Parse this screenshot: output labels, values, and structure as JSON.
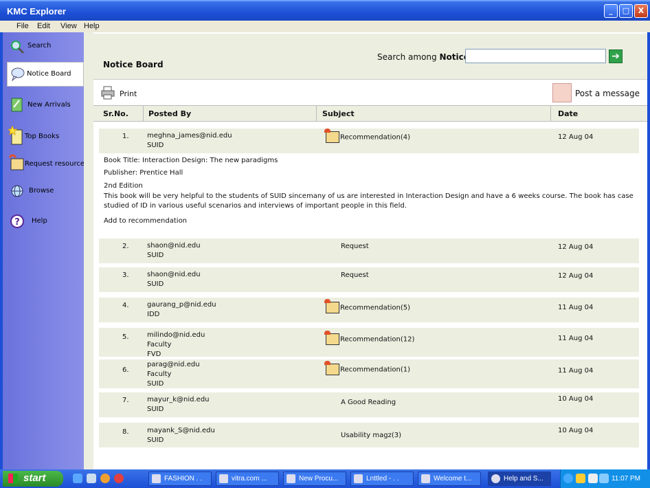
{
  "window": {
    "title": "KMC Explorer",
    "min": "_",
    "max": "□",
    "close": "X"
  },
  "menu": [
    "File",
    "Edit",
    "View",
    "Help"
  ],
  "sidebar": {
    "items": [
      {
        "label": "Search",
        "icon": "magnifier-icon"
      },
      {
        "label": "Notice Board",
        "icon": "speech-bubble-icon"
      },
      {
        "label": "New Arrivals",
        "icon": "book-icon"
      },
      {
        "label": "Top Books",
        "icon": "star-book-icon"
      },
      {
        "label": "Request resource",
        "icon": "folder-arrow-icon"
      },
      {
        "label": "Browse",
        "icon": "globe-icon"
      },
      {
        "label": "Help",
        "icon": "question-icon"
      }
    ]
  },
  "header": {
    "title": "Notice Board",
    "search_label": "Search among ",
    "search_label_bold": "Notices",
    "search_value": "",
    "go": "➔"
  },
  "toolbar": {
    "print": "Print",
    "post": "Post a message"
  },
  "table": {
    "columns": [
      "Sr.No.",
      "Posted By",
      "Subject",
      "Date"
    ],
    "rows": [
      {
        "num": "1.",
        "by": [
          "meghna_james@nid.edu",
          "SUID"
        ],
        "subject": "Recommendation(4)",
        "folder": true,
        "date": "12 Aug 04"
      },
      {
        "num": "2.",
        "by": [
          "shaon@nid.edu",
          "SUID"
        ],
        "subject": "Request",
        "folder": false,
        "date": "12 Aug 04"
      },
      {
        "num": "3.",
        "by": [
          "shaon@nid.edu",
          "SUID"
        ],
        "subject": "Request",
        "folder": false,
        "date": "12 Aug 04"
      },
      {
        "num": "4.",
        "by": [
          "gaurang_p@nid.edu",
          "IDD"
        ],
        "subject": "Recommendation(5)",
        "folder": true,
        "date": "11 Aug 04"
      },
      {
        "num": "5.",
        "by": [
          "milindo@nid.edu",
          "Faculty",
          "FVD"
        ],
        "subject": "Recommendation(12)",
        "folder": true,
        "date": "11 Aug 04"
      },
      {
        "num": "6.",
        "by": [
          "parag@nid.edu",
          "Faculty",
          "SUID"
        ],
        "subject": "Recommendation(1)",
        "folder": true,
        "date": "11 Aug 04"
      },
      {
        "num": "7.",
        "by": [
          "mayur_k@nid.edu",
          "SUID"
        ],
        "subject": "A Good Reading",
        "folder": false,
        "date": "10 Aug 04"
      },
      {
        "num": "8.",
        "by": [
          "mayank_S@nid.edu",
          "SUID"
        ],
        "subject": "Usability magz(3)",
        "folder": false,
        "date": "10 Aug 04"
      }
    ]
  },
  "detail": {
    "book_title": "Book Title: Interaction Design: The new paradigms",
    "publisher": "Publisher: Prentice Hall",
    "edition": "2nd Edition",
    "body": "This book will be very helpful to the students of SUID sincemany of us are interested in Interaction Design and have a 6 weeks  course. The book has case studied of ID in various useful scenarios and interviews of important people in this field.",
    "action": "Add to recommendation"
  },
  "taskbar": {
    "start": "start",
    "tasks": [
      "FASHION . .",
      "vitra.com  ...",
      "New Procu...",
      "Lnttled - . .",
      "Welcome t...",
      "Help and S..."
    ],
    "time": "11:07 PM"
  }
}
